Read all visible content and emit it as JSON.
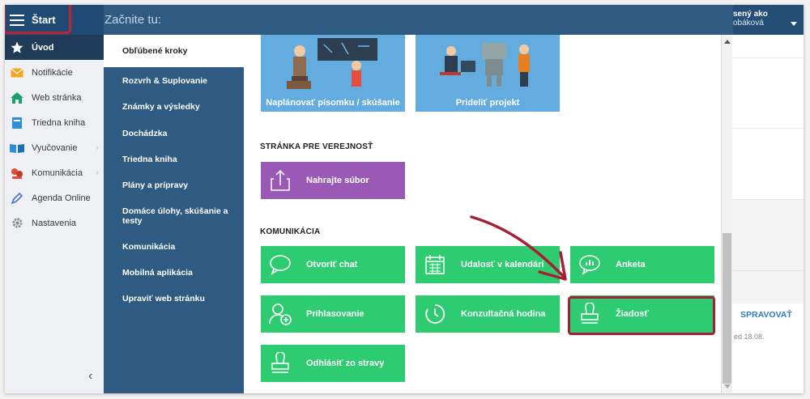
{
  "topbar": {
    "start_label": "Štart",
    "title": "Začnite tu:",
    "user_line1": "sený ako",
    "user_line2": "obáková"
  },
  "sidebar": {
    "items": [
      {
        "label": "Úvod",
        "icon": "star-icon"
      },
      {
        "label": "Notifikácie",
        "icon": "envelope-icon"
      },
      {
        "label": "Web stránka",
        "icon": "home-icon"
      },
      {
        "label": "Triedna kniha",
        "icon": "book-icon"
      },
      {
        "label": "Vyučovanie",
        "icon": "open-book-icon"
      },
      {
        "label": "Komunikácia",
        "icon": "chat-users-icon"
      },
      {
        "label": "Agenda Online",
        "icon": "pen-icon"
      },
      {
        "label": "Nastavenia",
        "icon": "gear-icon"
      }
    ],
    "collapse_glyph": "‹"
  },
  "midcol": {
    "items": [
      "Obľúbené kroky",
      "Rozvrh & Suplovanie",
      "Známky a výsledky",
      "Dochádzka",
      "Triedna kniha",
      "Plány a prípravy",
      "Domáce úlohy, skúšanie a testy",
      "Komunikácia",
      "Mobilná aplikácia",
      "Upraviť web stránku"
    ]
  },
  "content": {
    "top_tiles": [
      "Naplánovať písomku / skúšanie",
      "Prideliť projekt"
    ],
    "section_public": "STRÁNKA PRE VEREJNOSŤ",
    "upload_tile": "Nahrajte súbor",
    "section_comm": "KOMUNIKÁCIA",
    "tiles": {
      "chat": "Otvoriť chat",
      "event": "Udalosť v kalendári",
      "poll": "Anketa",
      "signup": "Prihlasovanie",
      "consult": "Konzultačná hodina",
      "request": "Žiadosť",
      "meal": "Odhlásiť zo stravy"
    }
  },
  "rightpanel": {
    "action": "SPRAVOVAŤ",
    "date": "ed 18.08."
  },
  "colors": {
    "topbar": "#2f5b82",
    "green": "#2ecc71",
    "purple": "#9b59b6",
    "blue_tile": "#63acdf",
    "highlight": "#a42035"
  }
}
